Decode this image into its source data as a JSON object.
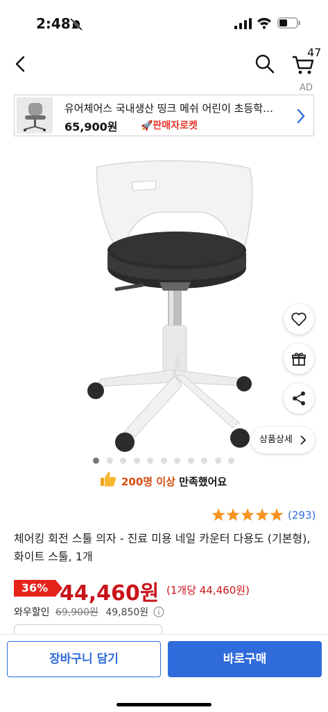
{
  "status_bar": {
    "time": "2:48"
  },
  "nav": {
    "cart_count": "47"
  },
  "ad": {
    "tag": "AD",
    "title": "유어체어스 국내생산 띵크 메쉬 어린이 초등학…",
    "price": "65,900원",
    "badge": "🚀판매자로켓"
  },
  "gallery": {
    "total_images": 11,
    "current_index": 0,
    "detail_button": "상품상세"
  },
  "satisfaction": {
    "highlight": "200명 이상",
    "suffix": "만족했어요"
  },
  "rating": {
    "stars": 5,
    "count": "(293)"
  },
  "product": {
    "title": "체어킹 회전 스툴 의자 - 진료 미용 네일 카운터 다용도 (기본형), 화이트 스툴, 1개",
    "discount": "36%",
    "price": "44,460원",
    "unit_price": "(1개당 44,460원)",
    "wow_label": "와우할인",
    "original_price": "69,900원",
    "wow_price": "49,850원"
  },
  "buttons": {
    "cart": "장바구니 담기",
    "buy": "바로구매"
  },
  "colors": {
    "accent": "#2f6bdb",
    "price_red": "#c8141a",
    "badge_red": "#e5231b"
  }
}
